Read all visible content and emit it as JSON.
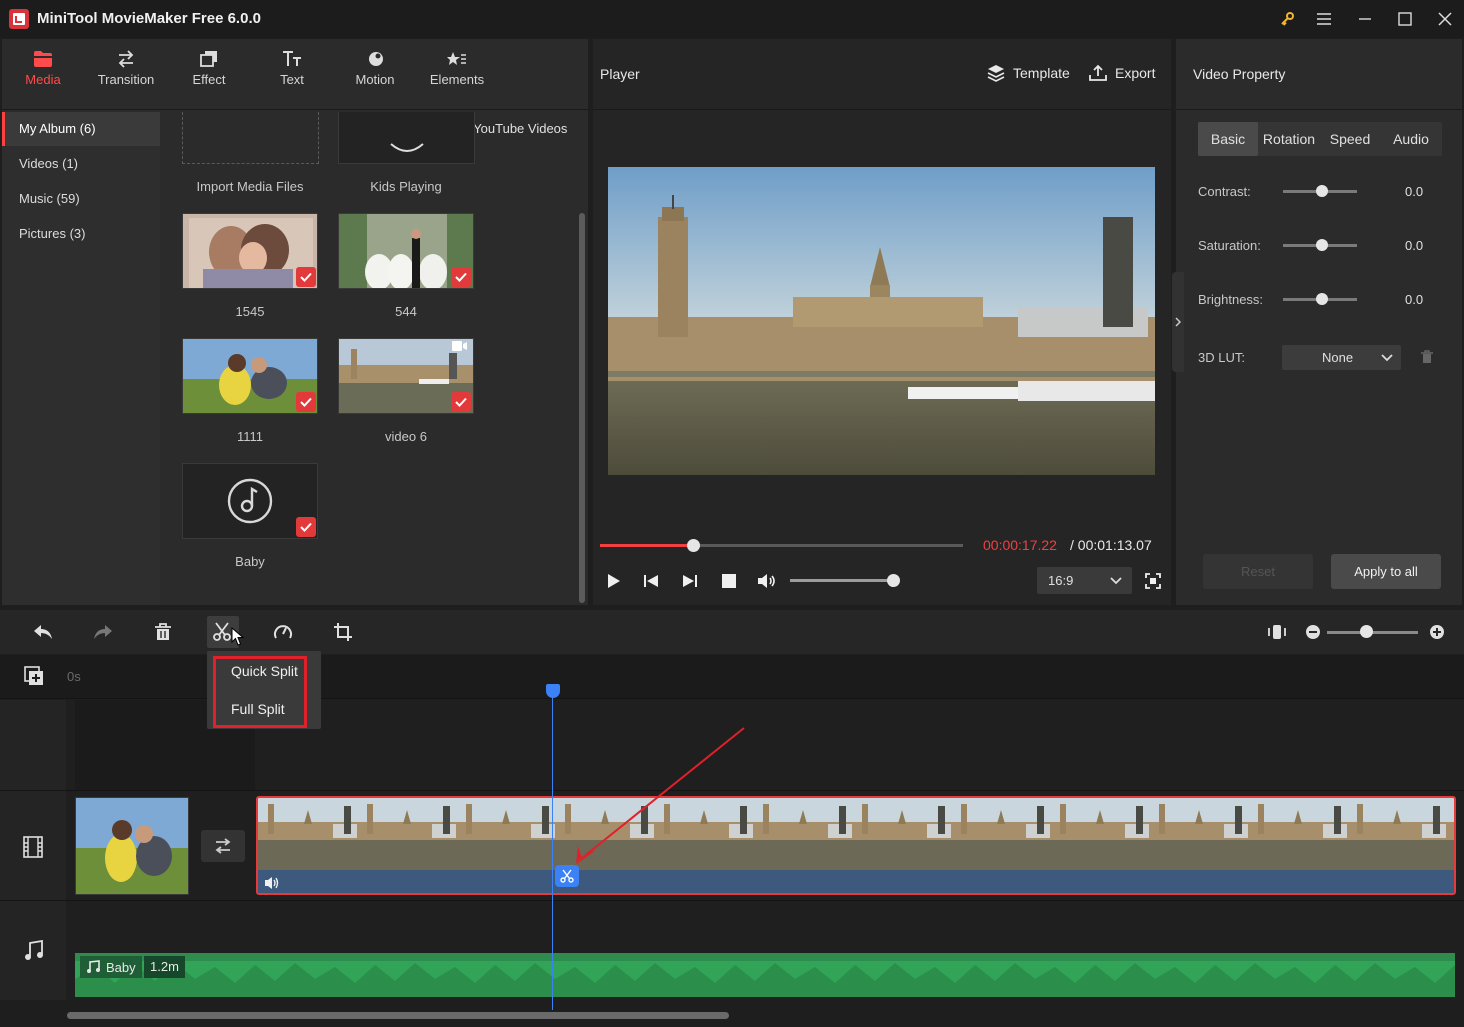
{
  "window": {
    "title": "MiniTool MovieMaker Free 6.0.0",
    "controls": [
      "key-icon",
      "menu-icon",
      "minimize-icon",
      "maximize-icon",
      "close-icon"
    ]
  },
  "categories": [
    {
      "label": "Media",
      "icon": "folder-icon",
      "active": true
    },
    {
      "label": "Transition",
      "icon": "swap-icon"
    },
    {
      "label": "Effect",
      "icon": "layers-icon"
    },
    {
      "label": "Text",
      "icon": "text-icon"
    },
    {
      "label": "Motion",
      "icon": "motion-icon"
    },
    {
      "label": "Elements",
      "icon": "elements-icon"
    }
  ],
  "albums": [
    {
      "label": "My Album (6)",
      "active": true
    },
    {
      "label": "Videos (1)"
    },
    {
      "label": "Music (59)"
    },
    {
      "label": "Pictures (3)"
    }
  ],
  "media": {
    "download_link": "Download YouTube Videos",
    "top_labels": [
      "Import Media Files",
      "Kids Playing"
    ],
    "items": [
      {
        "label": "1545",
        "checked": true
      },
      {
        "label": "544",
        "checked": true
      },
      {
        "label": "1111",
        "checked": true
      },
      {
        "label": "video 6",
        "checked": true,
        "badge": "video-camera-icon"
      },
      {
        "label": "Baby",
        "checked": true,
        "icon": "music-note-icon"
      }
    ]
  },
  "player": {
    "title": "Player",
    "template_label": "Template",
    "export_label": "Export",
    "time_current": "00:00:17.22",
    "time_total": "/ 00:01:13.07",
    "progress": 0.256,
    "volume": 0.95,
    "aspect_ratio": "16:9"
  },
  "property": {
    "title": "Video Property",
    "tabs": [
      "Basic",
      "Rotation",
      "Speed",
      "Audio"
    ],
    "active_tab": "Basic",
    "contrast_label": "Contrast:",
    "contrast_value": "0.0",
    "saturation_label": "Saturation:",
    "saturation_value": "0.0",
    "brightness_label": "Brightness:",
    "brightness_value": "0.0",
    "lut_label": "3D LUT:",
    "lut_value": "None",
    "reset_label": "Reset",
    "apply_label": "Apply to all"
  },
  "timeline": {
    "ruler_start": "0s",
    "split_menu": [
      "Quick Split",
      "Full Split"
    ],
    "music_clip": {
      "name": "Baby",
      "length": "1.2m"
    },
    "zoom": 0.45
  },
  "colors": {
    "accent_red": "#ff4b4b",
    "playhead_blue": "#3b82f6",
    "audio_green": "#2e8c4e"
  }
}
